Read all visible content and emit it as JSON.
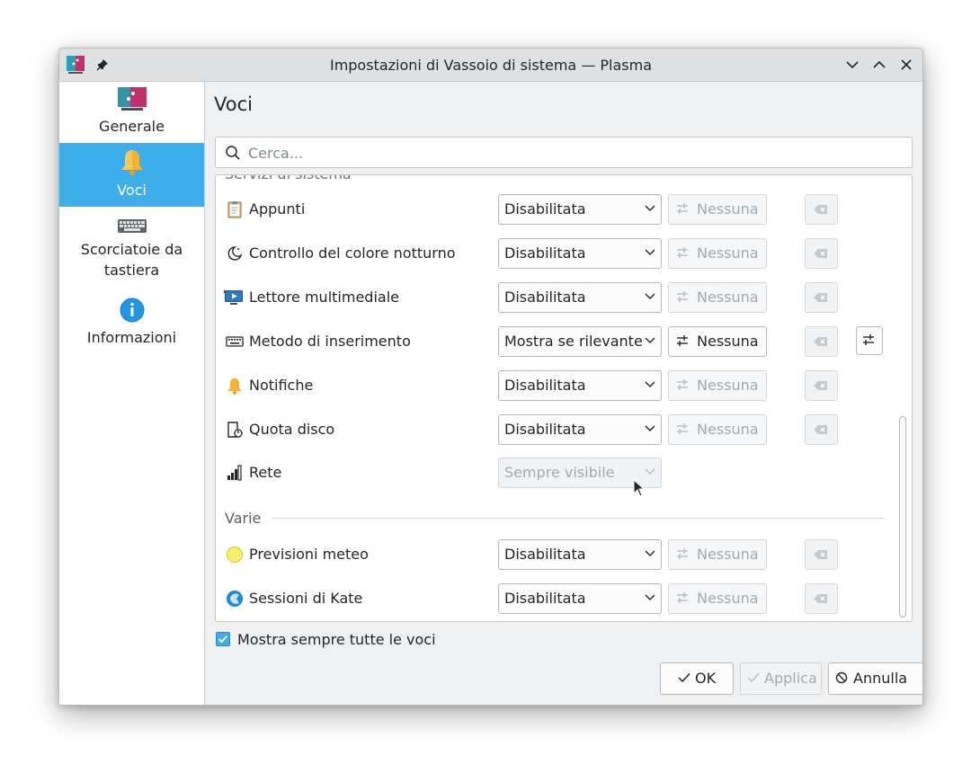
{
  "window": {
    "title": "Impostazioni di Vassoio di sistema — Plasma"
  },
  "sidebar": {
    "items": [
      {
        "label": "Generale",
        "icon": "system-tray-icon"
      },
      {
        "label": "Voci",
        "icon": "bell-icon",
        "active": true
      },
      {
        "label": "Scorciatoie da tastiera",
        "icon": "keyboard-icon"
      },
      {
        "label": "Informazioni",
        "icon": "info-icon"
      }
    ]
  },
  "page": {
    "title": "Voci"
  },
  "search": {
    "placeholder": "Cerca..."
  },
  "section_partial": "Servizi di sistema",
  "entries": [
    {
      "name": "Appunti",
      "icon": "clipboard-icon",
      "visibility": "Disabilitata",
      "shortcut": "Nessuna"
    },
    {
      "name": "Controllo del colore notturno",
      "icon": "night-color-icon",
      "visibility": "Disabilitata",
      "shortcut": "Nessuna"
    },
    {
      "name": "Lettore multimediale",
      "icon": "media-player-icon",
      "visibility": "Disabilitata",
      "shortcut": "Nessuna"
    },
    {
      "name": "Metodo di inserimento",
      "icon": "keyboard-icon",
      "visibility": "Mostra se rilevante",
      "shortcut": "Nessuna"
    },
    {
      "name": "Notifiche",
      "icon": "bell-icon",
      "visibility": "Disabilitata",
      "shortcut": "Nessuna"
    },
    {
      "name": "Quota disco",
      "icon": "disk-quota-icon",
      "visibility": "Disabilitata",
      "shortcut": "Nessuna"
    },
    {
      "name": "Rete",
      "icon": "network-icon",
      "visibility": "Sempre visibile"
    }
  ],
  "section_varie": "Varie",
  "entries_varie": [
    {
      "name": "Previsioni meteo",
      "icon": "weather-icon",
      "visibility": "Disabilitata",
      "shortcut": "Nessuna"
    },
    {
      "name": "Sessioni di Kate",
      "icon": "kate-icon",
      "visibility": "Disabilitata",
      "shortcut": "Nessuna"
    }
  ],
  "show_all": {
    "label": "Mostra sempre tutte le voci",
    "checked": true
  },
  "buttons": {
    "ok": "OK",
    "apply": "Applica",
    "cancel": "Annulla"
  },
  "colors": {
    "accent": "#3daee9",
    "window_bg": "#eff0f1"
  }
}
